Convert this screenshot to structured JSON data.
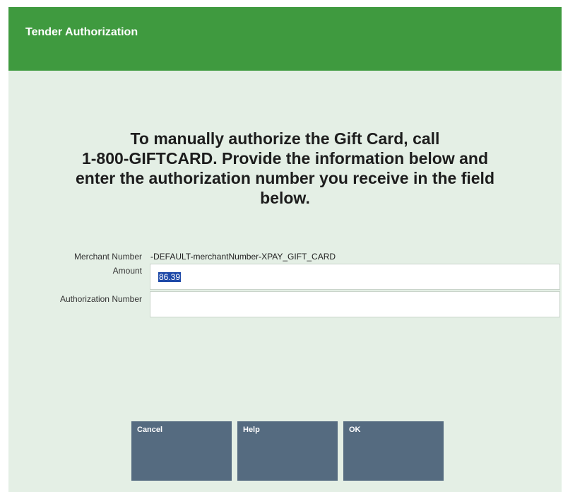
{
  "window": {
    "title": "Tender Authorization"
  },
  "message": {
    "lines": [
      "To manually authorize the Gift Card, call",
      "1-800-GIFTCARD.  Provide the information below and",
      "enter the authorization number you receive in the field",
      "below."
    ]
  },
  "form": {
    "merchant_number_label": "Merchant Number",
    "merchant_number_value": "-DEFAULT-merchantNumber-XPAY_GIFT_CARD",
    "amount_label": "Amount",
    "amount_value": "86.39",
    "authorization_number_label": "Authorization Number",
    "authorization_number_value": ""
  },
  "buttons": {
    "cancel": "Cancel",
    "help": "Help",
    "ok": "OK"
  },
  "colors": {
    "title_bar": "#3f9a3f",
    "background": "#e4efe5",
    "button": "#556b80",
    "selection": "#1f4aa8"
  }
}
